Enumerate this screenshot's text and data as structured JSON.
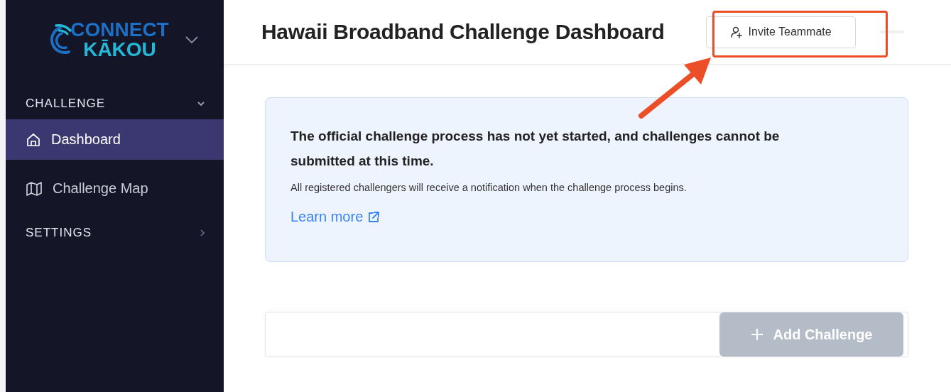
{
  "sidebar": {
    "logo": {
      "line_1": "CONNECT",
      "line_2": "KĀKOU"
    },
    "sections": [
      {
        "title": "CHALLENGE",
        "expanded": true,
        "items": [
          {
            "label": "Dashboard",
            "selected": true
          },
          {
            "label": "Challenge Map",
            "selected": false
          }
        ]
      },
      {
        "title": "SETTINGS",
        "expanded": false
      }
    ]
  },
  "header": {
    "title": "Hawaii Broadband Challenge Dashboard",
    "invite_button": "Invite Teammate"
  },
  "notice": {
    "heading": "The official challenge process has not yet started, and challenges cannot be submitted at this time.",
    "body": "All registered challengers will receive a notification when the challenge process begins.",
    "link": "Learn more"
  },
  "add_challenge": {
    "label": "Add Challenge",
    "disabled": true
  },
  "annotations": [
    {
      "kind": "box"
    },
    {
      "kind": "arrow"
    }
  ]
}
